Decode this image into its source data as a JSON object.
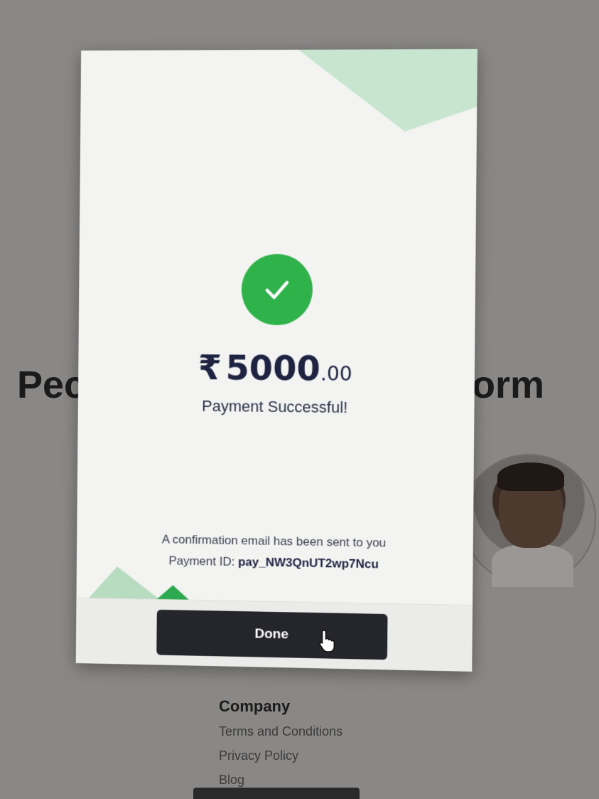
{
  "background": {
    "title_left": "Pec",
    "title_right": "orm",
    "footer": {
      "heading": "Company",
      "links": [
        "Terms and Conditions",
        "Privacy Policy",
        "Blog"
      ]
    }
  },
  "modal": {
    "currency_symbol": "₹",
    "amount_major": "5000",
    "amount_minor": ".00",
    "status_text": "Payment Successful!",
    "confirmation_text": "A confirmation email has been sent to you",
    "payment_id_label": "Payment ID:",
    "payment_id_value": "pay_NW3QnUT2wp7Ncu",
    "done_label": "Done"
  },
  "colors": {
    "success_green": "#2fb24a",
    "amount_navy": "#1d2340",
    "button_dark": "#25262b",
    "deco_light_green": "#c8e5cf"
  },
  "icons": [
    "check-icon",
    "hand-pointer-cursor-icon"
  ]
}
